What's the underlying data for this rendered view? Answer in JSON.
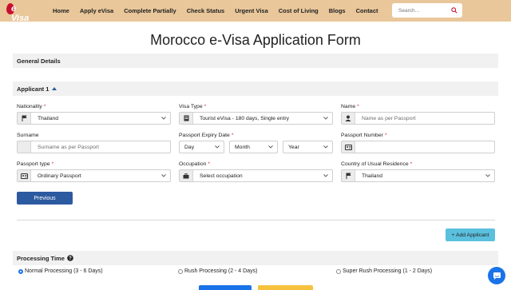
{
  "header": {
    "logo_text": "e Visa",
    "nav": [
      "Home",
      "Apply eVisa",
      "Complete Partially",
      "Check Status",
      "Urgent Visa",
      "Cost of Living",
      "Blogs",
      "Contact"
    ],
    "search_placeholder": "Search..."
  },
  "page_title": "Morocco e-Visa Application Form",
  "general_details": "General Details",
  "applicant": {
    "title": "Applicant 1",
    "nationality": {
      "label": "Nationality",
      "value": "Thailand"
    },
    "visa_type": {
      "label": "Visa Type",
      "value": "Tourist eVisa - 180 days, Single entry"
    },
    "name": {
      "label": "Name",
      "placeholder": "Name as per Passport"
    },
    "surname": {
      "label": "Surname",
      "placeholder": "Surname as per Passport"
    },
    "passport_expiry": {
      "label": "Passport Expiry Date",
      "day": "Day",
      "month": "Month",
      "year": "Year"
    },
    "passport_number": {
      "label": "Passport Number"
    },
    "passport_type": {
      "label": "Passport type",
      "value": "Ordinary Passport"
    },
    "occupation": {
      "label": "Occupation",
      "value": "Select occupation"
    },
    "residence": {
      "label": "Country of Usual Residence",
      "value": "Thailand"
    }
  },
  "buttons": {
    "previous": "Previous",
    "add_applicant": "+ Add Applicant"
  },
  "processing": {
    "title": "Processing Time",
    "options": [
      {
        "label": "Normal Processing (3 - 6 Days)",
        "selected": true
      },
      {
        "label": "Rush Processing (2 - 4 Days)",
        "selected": false
      },
      {
        "label": "Super Rush Processing (1 - 2 Days)",
        "selected": false
      }
    ]
  },
  "colors": {
    "header_bg": "#e9c79a",
    "primary": "#2c5aa0",
    "info": "#5bc0de",
    "required": "#d32f2f"
  }
}
